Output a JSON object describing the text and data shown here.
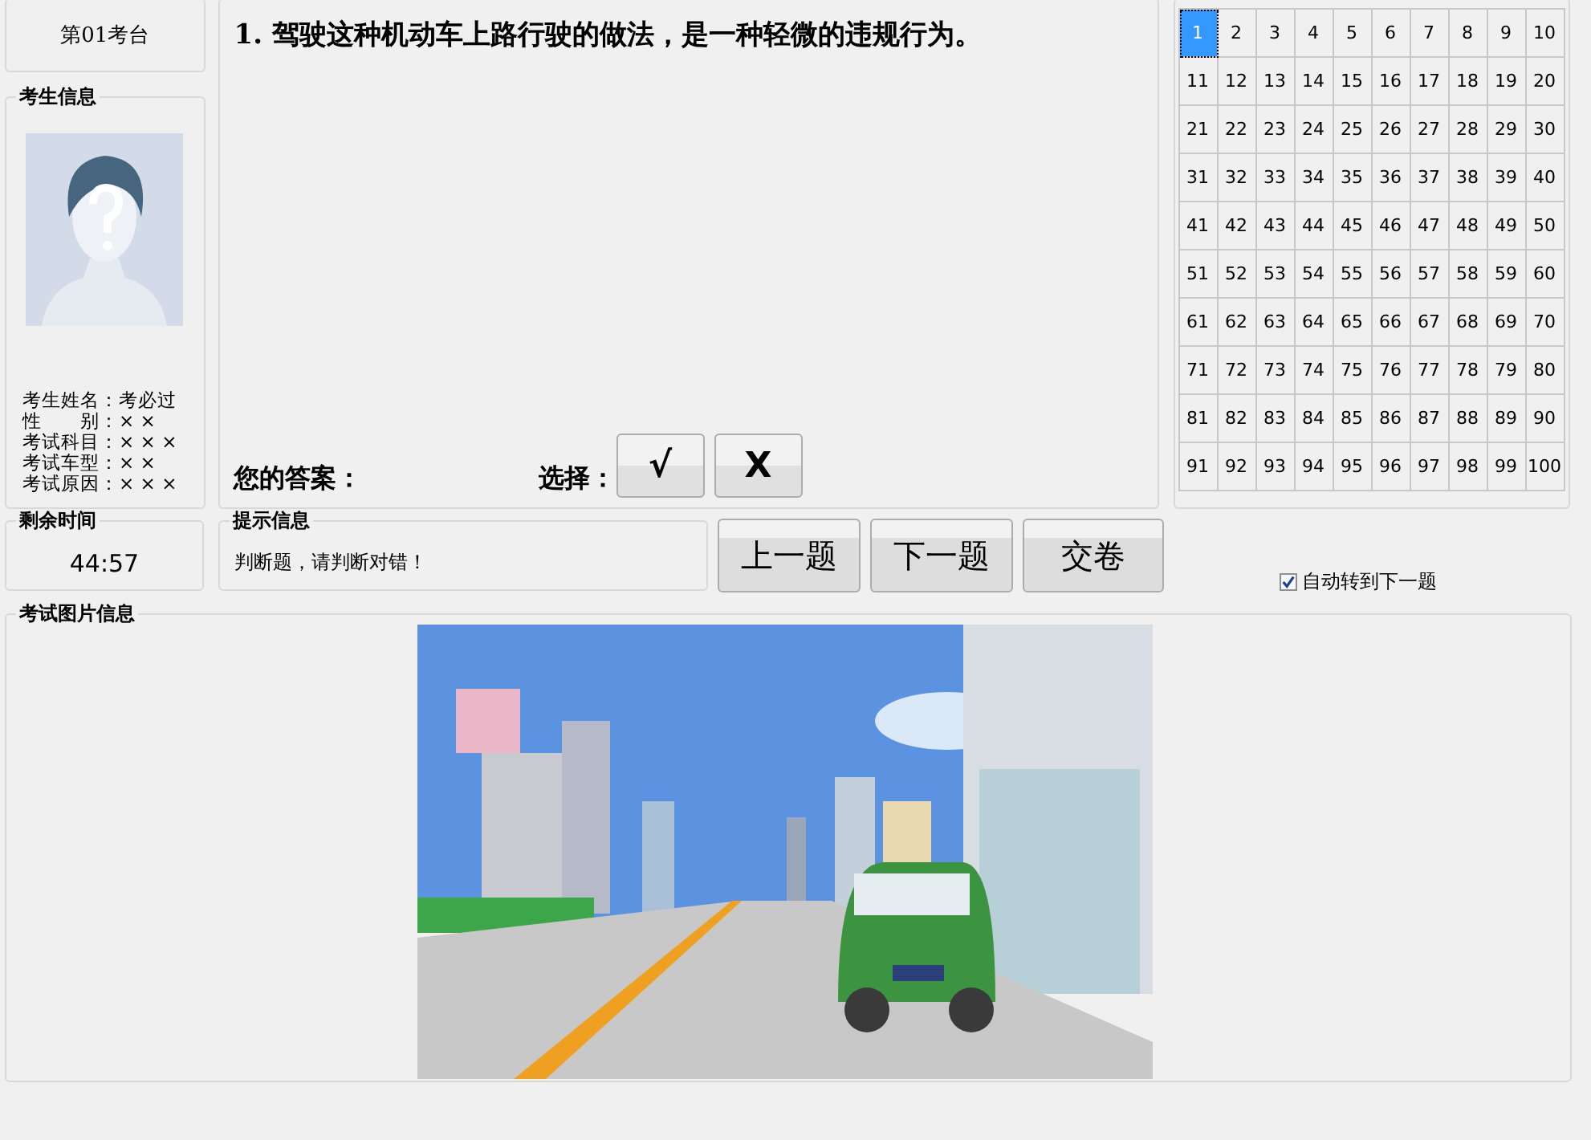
{
  "station": {
    "label": "第01考台"
  },
  "candidate": {
    "title": "考生信息",
    "fields": [
      "考生姓名：考必过",
      "性　　别：× ×",
      "考试科目：× × ×",
      "考试车型：× ×",
      "考试原因：× × ×"
    ]
  },
  "question": {
    "text": "1. 驾驶这种机动车上路行驶的做法，是一种轻微的违规行为。",
    "answer_label": "您的答案：",
    "choose_label": "选择：",
    "choices": [
      "√",
      "X"
    ]
  },
  "answer_grid": {
    "cells": [
      {
        "label": "1",
        "selected": true
      },
      {
        "label": "2",
        "selected": false
      },
      {
        "label": "3",
        "selected": false
      },
      {
        "label": "4",
        "selected": false
      },
      {
        "label": "5",
        "selected": false
      },
      {
        "label": "6",
        "selected": false
      },
      {
        "label": "7",
        "selected": false
      },
      {
        "label": "8",
        "selected": false
      },
      {
        "label": "9",
        "selected": false
      },
      {
        "label": "10",
        "selected": false
      },
      {
        "label": "11",
        "selected": false
      },
      {
        "label": "12",
        "selected": false
      },
      {
        "label": "13",
        "selected": false
      },
      {
        "label": "14",
        "selected": false
      },
      {
        "label": "15",
        "selected": false
      },
      {
        "label": "16",
        "selected": false
      },
      {
        "label": "17",
        "selected": false
      },
      {
        "label": "18",
        "selected": false
      },
      {
        "label": "19",
        "selected": false
      },
      {
        "label": "20",
        "selected": false
      },
      {
        "label": "21",
        "selected": false
      },
      {
        "label": "22",
        "selected": false
      },
      {
        "label": "23",
        "selected": false
      },
      {
        "label": "24",
        "selected": false
      },
      {
        "label": "25",
        "selected": false
      },
      {
        "label": "26",
        "selected": false
      },
      {
        "label": "27",
        "selected": false
      },
      {
        "label": "28",
        "selected": false
      },
      {
        "label": "29",
        "selected": false
      },
      {
        "label": "30",
        "selected": false
      },
      {
        "label": "31",
        "selected": false
      },
      {
        "label": "32",
        "selected": false
      },
      {
        "label": "33",
        "selected": false
      },
      {
        "label": "34",
        "selected": false
      },
      {
        "label": "35",
        "selected": false
      },
      {
        "label": "36",
        "selected": false
      },
      {
        "label": "37",
        "selected": false
      },
      {
        "label": "38",
        "selected": false
      },
      {
        "label": "39",
        "selected": false
      },
      {
        "label": "40",
        "selected": false
      },
      {
        "label": "41",
        "selected": false
      },
      {
        "label": "42",
        "selected": false
      },
      {
        "label": "43",
        "selected": false
      },
      {
        "label": "44",
        "selected": false
      },
      {
        "label": "45",
        "selected": false
      },
      {
        "label": "46",
        "selected": false
      },
      {
        "label": "47",
        "selected": false
      },
      {
        "label": "48",
        "selected": false
      },
      {
        "label": "49",
        "selected": false
      },
      {
        "label": "50",
        "selected": false
      },
      {
        "label": "51",
        "selected": false
      },
      {
        "label": "52",
        "selected": false
      },
      {
        "label": "53",
        "selected": false
      },
      {
        "label": "54",
        "selected": false
      },
      {
        "label": "55",
        "selected": false
      },
      {
        "label": "56",
        "selected": false
      },
      {
        "label": "57",
        "selected": false
      },
      {
        "label": "58",
        "selected": false
      },
      {
        "label": "59",
        "selected": false
      },
      {
        "label": "60",
        "selected": false
      },
      {
        "label": "61",
        "selected": false
      },
      {
        "label": "62",
        "selected": false
      },
      {
        "label": "63",
        "selected": false
      },
      {
        "label": "64",
        "selected": false
      },
      {
        "label": "65",
        "selected": false
      },
      {
        "label": "66",
        "selected": false
      },
      {
        "label": "67",
        "selected": false
      },
      {
        "label": "68",
        "selected": false
      },
      {
        "label": "69",
        "selected": false
      },
      {
        "label": "70",
        "selected": false
      },
      {
        "label": "71",
        "selected": false
      },
      {
        "label": "72",
        "selected": false
      },
      {
        "label": "73",
        "selected": false
      },
      {
        "label": "74",
        "selected": false
      },
      {
        "label": "75",
        "selected": false
      },
      {
        "label": "76",
        "selected": false
      },
      {
        "label": "77",
        "selected": false
      },
      {
        "label": "78",
        "selected": false
      },
      {
        "label": "79",
        "selected": false
      },
      {
        "label": "80",
        "selected": false
      },
      {
        "label": "81",
        "selected": false
      },
      {
        "label": "82",
        "selected": false
      },
      {
        "label": "83",
        "selected": false
      },
      {
        "label": "84",
        "selected": false
      },
      {
        "label": "85",
        "selected": false
      },
      {
        "label": "86",
        "selected": false
      },
      {
        "label": "87",
        "selected": false
      },
      {
        "label": "88",
        "selected": false
      },
      {
        "label": "89",
        "selected": false
      },
      {
        "label": "90",
        "selected": false
      },
      {
        "label": "91",
        "selected": false
      },
      {
        "label": "92",
        "selected": false
      },
      {
        "label": "93",
        "selected": false
      },
      {
        "label": "94",
        "selected": false
      },
      {
        "label": "95",
        "selected": false
      },
      {
        "label": "96",
        "selected": false
      },
      {
        "label": "97",
        "selected": false
      },
      {
        "label": "98",
        "selected": false
      },
      {
        "label": "99",
        "selected": false
      },
      {
        "label": "100",
        "selected": false
      }
    ]
  },
  "timer": {
    "title": "剩余时间",
    "value": "44:57"
  },
  "hint": {
    "title": "提示信息",
    "text": "判断题，请判断对错！"
  },
  "nav_buttons": [
    "上一题",
    "下一题",
    "交卷"
  ],
  "auto_next": {
    "label": "自动转到下一题",
    "checked": true
  },
  "picture": {
    "title": "考试图片信息"
  }
}
